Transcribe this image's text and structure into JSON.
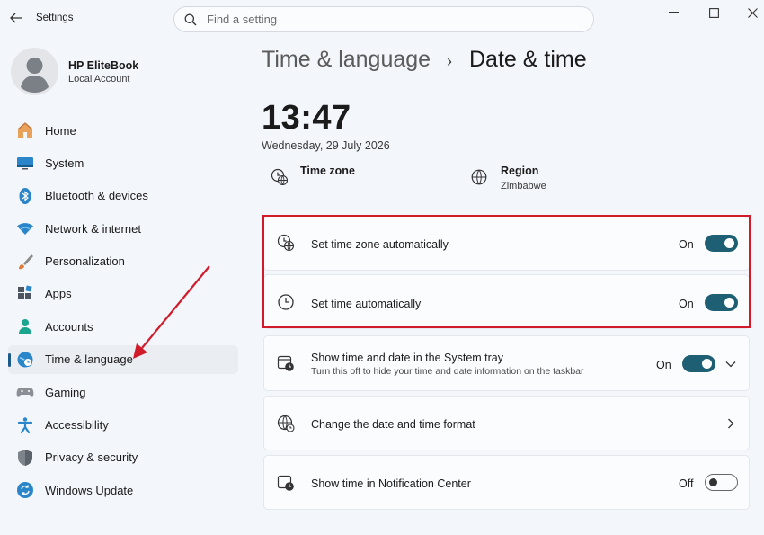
{
  "app": {
    "title": "Settings"
  },
  "search": {
    "placeholder": "Find a setting"
  },
  "profile": {
    "name": "HP EliteBook",
    "account_type": "Local Account"
  },
  "sidebar": {
    "items": [
      {
        "label": "Home",
        "icon": "home-icon"
      },
      {
        "label": "System",
        "icon": "system-icon"
      },
      {
        "label": "Bluetooth & devices",
        "icon": "bluetooth-icon"
      },
      {
        "label": "Network & internet",
        "icon": "wifi-icon"
      },
      {
        "label": "Personalization",
        "icon": "brush-icon"
      },
      {
        "label": "Apps",
        "icon": "apps-icon"
      },
      {
        "label": "Accounts",
        "icon": "accounts-icon"
      },
      {
        "label": "Time & language",
        "icon": "time-language-icon",
        "selected": true
      },
      {
        "label": "Gaming",
        "icon": "gamepad-icon"
      },
      {
        "label": "Accessibility",
        "icon": "accessibility-icon"
      },
      {
        "label": "Privacy & security",
        "icon": "shield-icon"
      },
      {
        "label": "Windows Update",
        "icon": "update-icon"
      }
    ]
  },
  "breadcrumb": {
    "parent": "Time & language",
    "separator": "›",
    "current": "Date & time"
  },
  "clock": {
    "time": "13:47",
    "date": "Wednesday, 29 July 2026"
  },
  "summary": {
    "time_zone": {
      "label": "Time zone",
      "value": ""
    },
    "region": {
      "label": "Region",
      "value": "Zimbabwe"
    }
  },
  "settings": [
    {
      "title": "Set time zone automatically",
      "state": "On",
      "toggle": true,
      "icon": "globe-clock-icon"
    },
    {
      "title": "Set time automatically",
      "state": "On",
      "toggle": true,
      "icon": "clock-icon"
    },
    {
      "title": "Show time and date in the System tray",
      "subtitle": "Turn this off to hide your time and date information on the taskbar",
      "state": "On",
      "toggle": true,
      "expandable": true,
      "icon": "calendar-clock-icon"
    },
    {
      "title": "Change the date and time format",
      "navigates": true,
      "icon": "globe-format-icon"
    },
    {
      "title": "Show time in Notification Center",
      "state": "Off",
      "toggle": false,
      "icon": "notification-clock-icon"
    }
  ],
  "colors": {
    "accent": "#1e5f73",
    "highlight": "#d11b2b",
    "background": "#f3f6fb"
  }
}
